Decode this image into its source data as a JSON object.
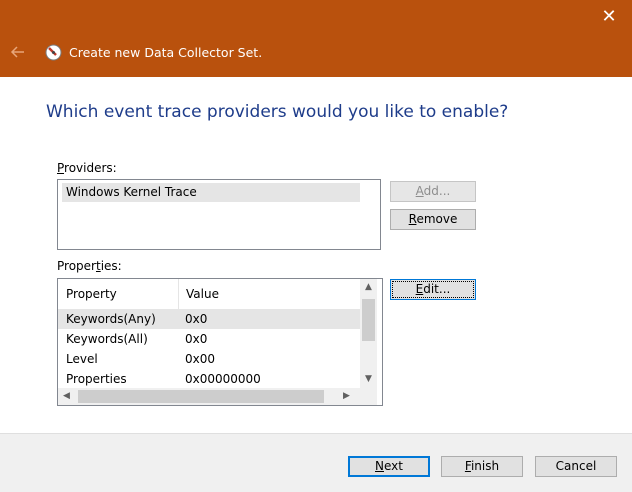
{
  "window": {
    "title": "Create new Data Collector Set.",
    "close_glyph": "✕",
    "accent_color": "#b9510d"
  },
  "headline": "Which event trace providers would you like to enable?",
  "providers": {
    "label_pre": "",
    "label_ul": "P",
    "label_post": "roviders:",
    "items": [
      "Windows Kernel Trace"
    ]
  },
  "buttons": {
    "add": {
      "pre": "",
      "ul": "A",
      "post": "dd..."
    },
    "remove": {
      "pre": "",
      "ul": "R",
      "post": "emove"
    },
    "edit": {
      "pre": "",
      "ul": "E",
      "post": "dit..."
    },
    "next": {
      "pre": "",
      "ul": "N",
      "post": "ext"
    },
    "finish": {
      "pre": "",
      "ul": "F",
      "post": "inish"
    },
    "cancel": {
      "label": "Cancel"
    }
  },
  "properties": {
    "label_pre": "Proper",
    "label_ul": "t",
    "label_post": "ies:",
    "columns": [
      "Property",
      "Value"
    ],
    "rows": [
      {
        "property": "Keywords(Any)",
        "value": "0x0"
      },
      {
        "property": "Keywords(All)",
        "value": "0x0"
      },
      {
        "property": "Level",
        "value": "0x00"
      },
      {
        "property": "Properties",
        "value": "0x00000000"
      }
    ]
  }
}
